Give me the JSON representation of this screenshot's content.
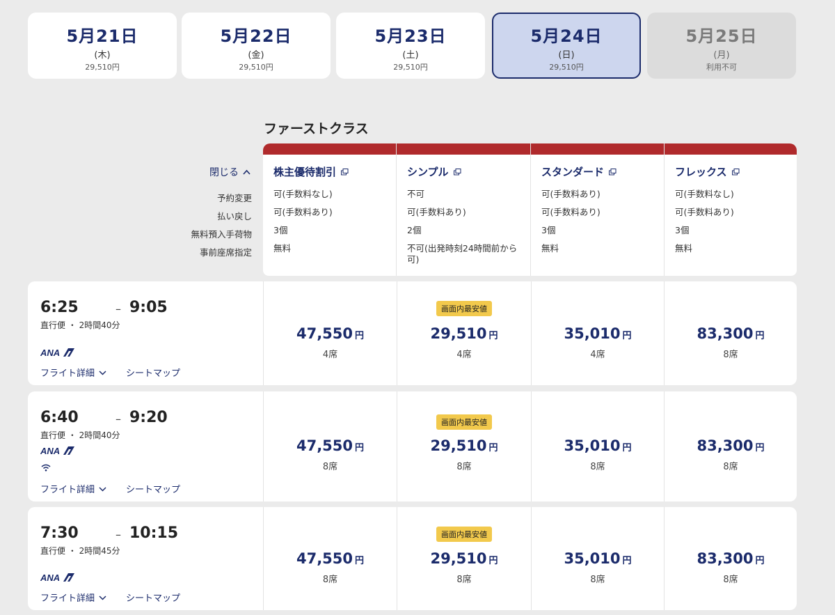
{
  "dates": [
    {
      "date": "5月21日",
      "weekday": "(木)",
      "price": "29,510円"
    },
    {
      "date": "5月22日",
      "weekday": "(金)",
      "price": "29,510円"
    },
    {
      "date": "5月23日",
      "weekday": "(土)",
      "price": "29,510円"
    },
    {
      "date": "5月24日",
      "weekday": "(日)",
      "price": "29,510円",
      "selected": true
    },
    {
      "date": "5月25日",
      "weekday": "(月)",
      "price": "利用不可",
      "disabled": true
    }
  ],
  "class_title": "ファーストクラス",
  "close_label": "閉じる",
  "condition_labels": [
    "予約変更",
    "払い戻し",
    "無料預入手荷物",
    "事前座席指定"
  ],
  "fares": [
    {
      "name": "株主優待割引",
      "conditions": [
        "可(手数料なし)",
        "可(手数料あり)",
        "3個",
        "無料"
      ]
    },
    {
      "name": "シンプル",
      "conditions": [
        "不可",
        "可(手数料あり)",
        "2個",
        "不可(出発時刻24時間前から可)"
      ]
    },
    {
      "name": "スタンダード",
      "conditions": [
        "可(手数料あり)",
        "可(手数料あり)",
        "3個",
        "無料"
      ]
    },
    {
      "name": "フレックス",
      "conditions": [
        "可(手数料なし)",
        "可(手数料あり)",
        "3個",
        "無料"
      ]
    }
  ],
  "lowest_badge": "画面内最安値",
  "yen": "円",
  "flight_detail_label": "フライト詳細",
  "seat_map_label": "シートマップ",
  "airline": "ANA",
  "flights": [
    {
      "dep": "6:25",
      "dash": "–",
      "arr": "9:05",
      "duration": "直行便 ・ 2時間40分",
      "wifi": false,
      "prices": [
        {
          "amount": "47,550",
          "seats": "4席"
        },
        {
          "amount": "29,510",
          "seats": "4席"
        },
        {
          "amount": "35,010",
          "seats": "4席"
        },
        {
          "amount": "83,300",
          "seats": "8席"
        }
      ]
    },
    {
      "dep": "6:40",
      "dash": "–",
      "arr": "9:20",
      "duration": "直行便 ・ 2時間40分",
      "wifi": true,
      "prices": [
        {
          "amount": "47,550",
          "seats": "8席"
        },
        {
          "amount": "29,510",
          "seats": "8席"
        },
        {
          "amount": "35,010",
          "seats": "8席"
        },
        {
          "amount": "83,300",
          "seats": "8席"
        }
      ]
    },
    {
      "dep": "7:30",
      "dash": "–",
      "arr": "10:15",
      "duration": "直行便 ・ 2時間45分",
      "wifi": false,
      "prices": [
        {
          "amount": "47,550",
          "seats": "8席"
        },
        {
          "amount": "29,510",
          "seats": "8席"
        },
        {
          "amount": "35,010",
          "seats": "8席"
        },
        {
          "amount": "83,300",
          "seats": "8席"
        }
      ]
    }
  ],
  "colors": {
    "navy": "#1b2b6b",
    "red": "#b02a2c",
    "badge": "#f2c94c",
    "background": "#ebebeb"
  }
}
